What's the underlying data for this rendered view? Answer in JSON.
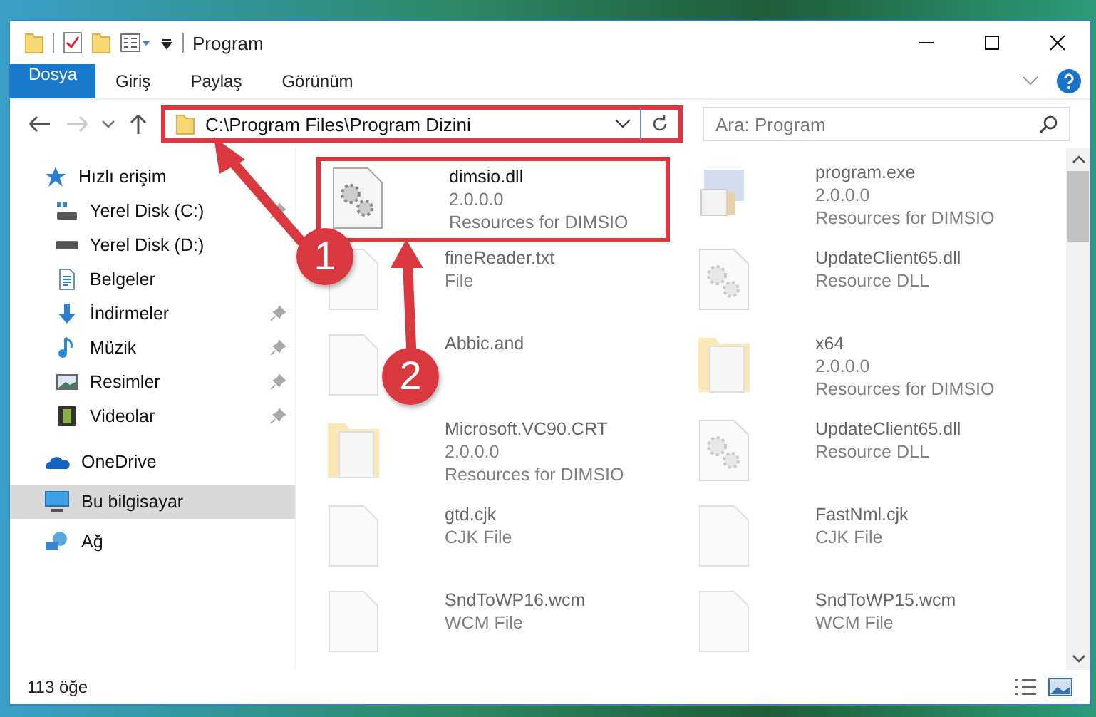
{
  "window": {
    "title": "Program"
  },
  "ribbon_tabs": [
    {
      "label": "Dosya",
      "kind": "file"
    },
    {
      "label": "Giriş",
      "kind": "tab"
    },
    {
      "label": "Paylaş",
      "kind": "tab"
    },
    {
      "label": "Görünüm",
      "kind": "tab"
    }
  ],
  "address_bar": {
    "value": "C:\\Program Files\\Program Dizini",
    "highlighted": true
  },
  "search": {
    "placeholder": "Ara: Program"
  },
  "sidebar": {
    "items": [
      {
        "label": "Hızlı erişim",
        "kind": "star",
        "pinned": false,
        "selected": false
      },
      {
        "label": "Yerel Disk (C:)",
        "kind": "drive-c",
        "pinned": true,
        "selected": false
      },
      {
        "label": "Yerel Disk (D:)",
        "kind": "drive",
        "pinned": false,
        "selected": false
      },
      {
        "label": "Belgeler",
        "kind": "docs",
        "pinned": false,
        "selected": false
      },
      {
        "label": "İndirmeler",
        "kind": "download",
        "pinned": true,
        "selected": false
      },
      {
        "label": "Müzik",
        "kind": "music",
        "pinned": true,
        "selected": false
      },
      {
        "label": "Resimler",
        "kind": "pictures",
        "pinned": true,
        "selected": false
      },
      {
        "label": "Videolar",
        "kind": "videos",
        "pinned": true,
        "selected": false
      },
      {
        "label": "OneDrive",
        "kind": "cloud",
        "pinned": false,
        "selected": false
      },
      {
        "label": "Bu bilgisayar",
        "kind": "computer",
        "pinned": false,
        "selected": true
      },
      {
        "label": "Ağ",
        "kind": "network",
        "pinned": false,
        "selected": false
      }
    ]
  },
  "files": [
    {
      "name": "dimsio.dll",
      "details": [
        "2.0.0.0",
        "Resources for DIMSIO"
      ],
      "kind": "dll",
      "blurred": false,
      "highlighted": true
    },
    {
      "name": "program.exe",
      "details": [
        "2.0.0.0",
        "Resources for DIMSIO"
      ],
      "kind": "exe",
      "blurred": true,
      "highlighted": false
    },
    {
      "name": "fineReader.txt",
      "details": [
        "File"
      ],
      "kind": "text",
      "blurred": true,
      "highlighted": false
    },
    {
      "name": "UpdateClient65.dll",
      "details": [
        "Resource DLL"
      ],
      "kind": "dll",
      "blurred": true,
      "highlighted": false
    },
    {
      "name": "Abbic.and",
      "kind": "text",
      "blurred": true,
      "highlighted": false
    },
    {
      "name": "x64",
      "details": [
        "2.0.0.0",
        "Resources for DIMSIO"
      ],
      "kind": "folder",
      "blurred": true,
      "highlighted": false
    },
    {
      "name": "Microsoft.VC90.CRT",
      "details": [
        "2.0.0.0",
        "Resources for DIMSIO"
      ],
      "kind": "folder",
      "blurred": true,
      "highlighted": false
    },
    {
      "name": "UpdateClient65.dll",
      "details": [
        "Resource DLL"
      ],
      "kind": "dll",
      "blurred": true,
      "highlighted": false
    },
    {
      "name": "gtd.cjk",
      "details": [
        "CJK File"
      ],
      "kind": "text",
      "blurred": true,
      "highlighted": false
    },
    {
      "name": "FastNml.cjk",
      "details": [
        "CJK File"
      ],
      "kind": "text",
      "blurred": true,
      "highlighted": false
    },
    {
      "name": "SndToWP16.wcm",
      "details": [
        "WCM File"
      ],
      "kind": "text",
      "blurred": true,
      "highlighted": false
    },
    {
      "name": "SndToWP15.wcm",
      "details": [
        "WCM File"
      ],
      "kind": "text",
      "blurred": true,
      "highlighted": false
    }
  ],
  "status_bar": {
    "count": "113 öğe"
  },
  "annotations": [
    {
      "number": "1"
    },
    {
      "number": "2"
    }
  ]
}
